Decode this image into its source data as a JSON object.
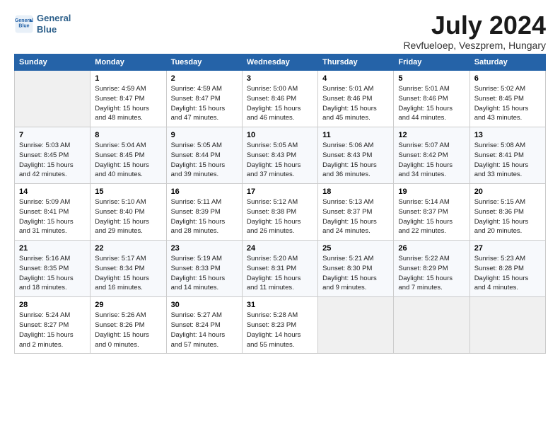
{
  "logo": {
    "line1": "General",
    "line2": "Blue"
  },
  "title": "July 2024",
  "subtitle": "Revfueloep, Veszprem, Hungary",
  "days_header": [
    "Sunday",
    "Monday",
    "Tuesday",
    "Wednesday",
    "Thursday",
    "Friday",
    "Saturday"
  ],
  "weeks": [
    [
      {
        "day": "",
        "info": ""
      },
      {
        "day": "1",
        "info": "Sunrise: 4:59 AM\nSunset: 8:47 PM\nDaylight: 15 hours\nand 48 minutes."
      },
      {
        "day": "2",
        "info": "Sunrise: 4:59 AM\nSunset: 8:47 PM\nDaylight: 15 hours\nand 47 minutes."
      },
      {
        "day": "3",
        "info": "Sunrise: 5:00 AM\nSunset: 8:46 PM\nDaylight: 15 hours\nand 46 minutes."
      },
      {
        "day": "4",
        "info": "Sunrise: 5:01 AM\nSunset: 8:46 PM\nDaylight: 15 hours\nand 45 minutes."
      },
      {
        "day": "5",
        "info": "Sunrise: 5:01 AM\nSunset: 8:46 PM\nDaylight: 15 hours\nand 44 minutes."
      },
      {
        "day": "6",
        "info": "Sunrise: 5:02 AM\nSunset: 8:45 PM\nDaylight: 15 hours\nand 43 minutes."
      }
    ],
    [
      {
        "day": "7",
        "info": "Sunrise: 5:03 AM\nSunset: 8:45 PM\nDaylight: 15 hours\nand 42 minutes."
      },
      {
        "day": "8",
        "info": "Sunrise: 5:04 AM\nSunset: 8:45 PM\nDaylight: 15 hours\nand 40 minutes."
      },
      {
        "day": "9",
        "info": "Sunrise: 5:05 AM\nSunset: 8:44 PM\nDaylight: 15 hours\nand 39 minutes."
      },
      {
        "day": "10",
        "info": "Sunrise: 5:05 AM\nSunset: 8:43 PM\nDaylight: 15 hours\nand 37 minutes."
      },
      {
        "day": "11",
        "info": "Sunrise: 5:06 AM\nSunset: 8:43 PM\nDaylight: 15 hours\nand 36 minutes."
      },
      {
        "day": "12",
        "info": "Sunrise: 5:07 AM\nSunset: 8:42 PM\nDaylight: 15 hours\nand 34 minutes."
      },
      {
        "day": "13",
        "info": "Sunrise: 5:08 AM\nSunset: 8:41 PM\nDaylight: 15 hours\nand 33 minutes."
      }
    ],
    [
      {
        "day": "14",
        "info": "Sunrise: 5:09 AM\nSunset: 8:41 PM\nDaylight: 15 hours\nand 31 minutes."
      },
      {
        "day": "15",
        "info": "Sunrise: 5:10 AM\nSunset: 8:40 PM\nDaylight: 15 hours\nand 29 minutes."
      },
      {
        "day": "16",
        "info": "Sunrise: 5:11 AM\nSunset: 8:39 PM\nDaylight: 15 hours\nand 28 minutes."
      },
      {
        "day": "17",
        "info": "Sunrise: 5:12 AM\nSunset: 8:38 PM\nDaylight: 15 hours\nand 26 minutes."
      },
      {
        "day": "18",
        "info": "Sunrise: 5:13 AM\nSunset: 8:37 PM\nDaylight: 15 hours\nand 24 minutes."
      },
      {
        "day": "19",
        "info": "Sunrise: 5:14 AM\nSunset: 8:37 PM\nDaylight: 15 hours\nand 22 minutes."
      },
      {
        "day": "20",
        "info": "Sunrise: 5:15 AM\nSunset: 8:36 PM\nDaylight: 15 hours\nand 20 minutes."
      }
    ],
    [
      {
        "day": "21",
        "info": "Sunrise: 5:16 AM\nSunset: 8:35 PM\nDaylight: 15 hours\nand 18 minutes."
      },
      {
        "day": "22",
        "info": "Sunrise: 5:17 AM\nSunset: 8:34 PM\nDaylight: 15 hours\nand 16 minutes."
      },
      {
        "day": "23",
        "info": "Sunrise: 5:19 AM\nSunset: 8:33 PM\nDaylight: 15 hours\nand 14 minutes."
      },
      {
        "day": "24",
        "info": "Sunrise: 5:20 AM\nSunset: 8:31 PM\nDaylight: 15 hours\nand 11 minutes."
      },
      {
        "day": "25",
        "info": "Sunrise: 5:21 AM\nSunset: 8:30 PM\nDaylight: 15 hours\nand 9 minutes."
      },
      {
        "day": "26",
        "info": "Sunrise: 5:22 AM\nSunset: 8:29 PM\nDaylight: 15 hours\nand 7 minutes."
      },
      {
        "day": "27",
        "info": "Sunrise: 5:23 AM\nSunset: 8:28 PM\nDaylight: 15 hours\nand 4 minutes."
      }
    ],
    [
      {
        "day": "28",
        "info": "Sunrise: 5:24 AM\nSunset: 8:27 PM\nDaylight: 15 hours\nand 2 minutes."
      },
      {
        "day": "29",
        "info": "Sunrise: 5:26 AM\nSunset: 8:26 PM\nDaylight: 15 hours\nand 0 minutes."
      },
      {
        "day": "30",
        "info": "Sunrise: 5:27 AM\nSunset: 8:24 PM\nDaylight: 14 hours\nand 57 minutes."
      },
      {
        "day": "31",
        "info": "Sunrise: 5:28 AM\nSunset: 8:23 PM\nDaylight: 14 hours\nand 55 minutes."
      },
      {
        "day": "",
        "info": ""
      },
      {
        "day": "",
        "info": ""
      },
      {
        "day": "",
        "info": ""
      }
    ]
  ]
}
